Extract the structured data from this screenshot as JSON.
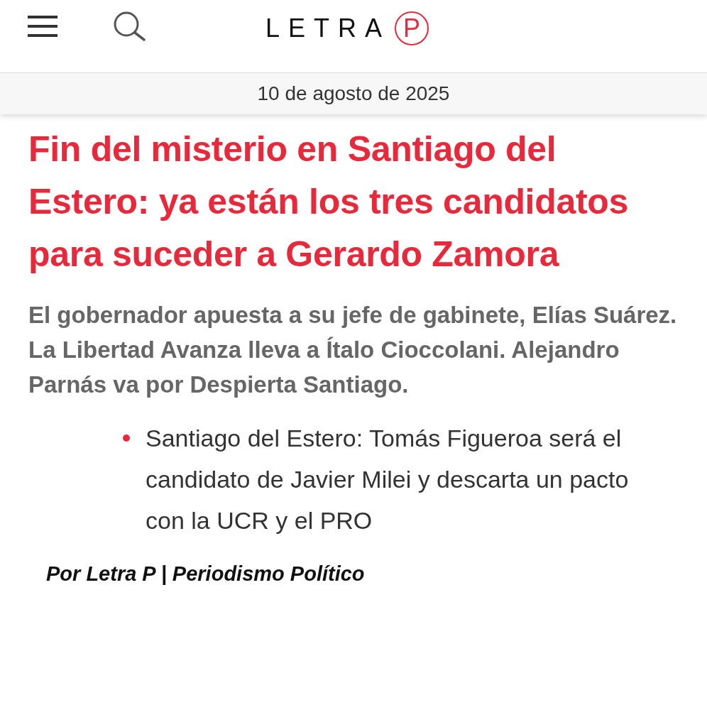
{
  "header": {
    "logo": {
      "text": "LETRA",
      "mark": "P"
    }
  },
  "date": "10 de agosto de 2025",
  "headline": "Fin del misterio en Santiago del Estero: ya están los tres candidatos para suceder a Gerardo Zamora",
  "summary": "El gobernador apuesta a su jefe de gabinete, Elías Suárez. La Libertad Avanza lleva a Ítalo Cioccolani. Alejandro Parnás va por Despierta Santiago.",
  "related": [
    "Santiago del Estero: Tomás Figueroa será el candidato de Javier Milei y descarta un pacto con la UCR y el PRO"
  ],
  "byline": "Por Letra P | Periodismo Político"
}
